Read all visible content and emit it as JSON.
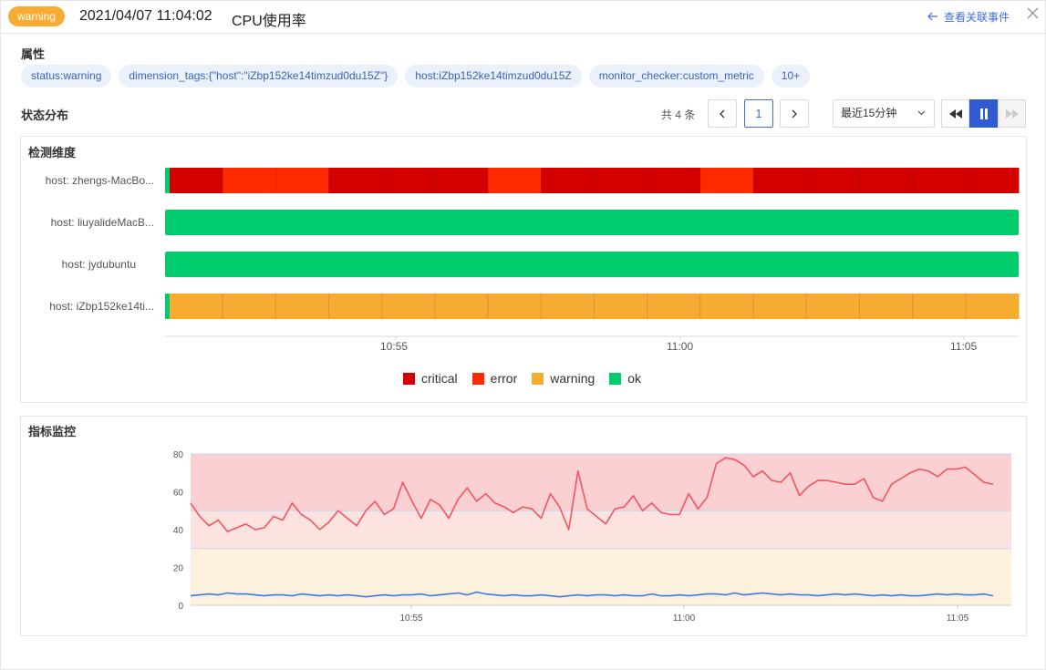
{
  "header": {
    "status_badge": "warning",
    "time": "2021/04/07 11:04:02",
    "title": "CPU使用率",
    "related_link": "查看关联事件"
  },
  "attributes": {
    "title": "属性",
    "tags": [
      "status:warning",
      "dimension_tags:{\"host\":\"iZbp152ke14timzud0du15Z\"}",
      "host:iZbp152ke14timzud0du15Z",
      "monitor_checker:custom_metric",
      "10+"
    ]
  },
  "status_dist": {
    "title": "状态分布",
    "total": "共 4 条",
    "page": "1",
    "time_range": "最近15分钟"
  },
  "detection": {
    "title": "检测维度",
    "rows": [
      {
        "label": "host: zhengs-MacBo...",
        "segments": [
          "ok",
          "critical",
          "error",
          "error",
          "critical",
          "critical",
          "critical",
          "error",
          "critical",
          "critical",
          "critical",
          "error",
          "critical",
          "critical",
          "critical",
          "critical",
          "critical"
        ]
      },
      {
        "label": "host: liuyalideMacB...",
        "segments": [
          "ok"
        ]
      },
      {
        "label": "host: jydubuntu",
        "segments": [
          "ok"
        ]
      },
      {
        "label": "host: iZbp152ke14ti...",
        "segments": [
          "ok",
          "warning",
          "warning",
          "warning",
          "warning",
          "warning",
          "warning",
          "warning",
          "warning",
          "warning",
          "warning",
          "warning",
          "warning",
          "warning",
          "warning",
          "warning",
          "warning"
        ]
      }
    ],
    "x_ticks": [
      "10:55",
      "11:00",
      "11:05"
    ],
    "colors": {
      "critical": "#d40000",
      "error": "#ff2a00",
      "warning": "#f7ab31",
      "ok": "#00cc6e"
    },
    "legend": [
      "critical",
      "error",
      "warning",
      "ok"
    ]
  },
  "metrics": {
    "title": "指标监控"
  },
  "chart_data": {
    "type": "line",
    "x_ticks": [
      "10:55",
      "11:00",
      "11:05"
    ],
    "y_ticks": [
      0,
      20,
      40,
      60,
      80
    ],
    "ylim": [
      0,
      80
    ],
    "thresholds": [
      {
        "from": 50,
        "to": 80,
        "color": "#fbd0d2"
      },
      {
        "from": 30,
        "to": 50,
        "color": "#fde3df"
      },
      {
        "from": 0,
        "to": 30,
        "color": "#fdf0dc"
      }
    ],
    "series": [
      {
        "color": "#f25562",
        "values": [
          54,
          47,
          42,
          45,
          39,
          41,
          43,
          40,
          41,
          47,
          45,
          54,
          48,
          45,
          40,
          44,
          50,
          46,
          42,
          50,
          55,
          48,
          51,
          65,
          55,
          46,
          56,
          53,
          46,
          56,
          62,
          55,
          59,
          54,
          52,
          49,
          52,
          51,
          46,
          59,
          52,
          40,
          71,
          51,
          47,
          43,
          51,
          52,
          58,
          50,
          54,
          49,
          48,
          48,
          59,
          51,
          57,
          75,
          78,
          77,
          74,
          68,
          71,
          66,
          65,
          70,
          58,
          63,
          66,
          66,
          65,
          64,
          64,
          67,
          57,
          55,
          64,
          67,
          70,
          72,
          71,
          68,
          72,
          72,
          73,
          69,
          65,
          64
        ]
      },
      {
        "color": "#3f78e8",
        "values": [
          5,
          5.5,
          6,
          5.5,
          6.5,
          6,
          6,
          5.5,
          5,
          5.5,
          5.5,
          5,
          6,
          5.5,
          5,
          5.5,
          5,
          5.5,
          5,
          4.5,
          5,
          5.5,
          5,
          5.5,
          5.5,
          6,
          5,
          5.5,
          6,
          6.5,
          5.5,
          7,
          6,
          5.5,
          5,
          5.5,
          5,
          5,
          5.5,
          5,
          4.5,
          5,
          5.5,
          5,
          5.5,
          5.5,
          5,
          5.5,
          5,
          5,
          6,
          5,
          5,
          5.5,
          5,
          5.5,
          6,
          6,
          5.5,
          6.5,
          5.5,
          6,
          6.5,
          6,
          5.5,
          6,
          5.5,
          5.5,
          5,
          5.5,
          6,
          5.5,
          6,
          5.5,
          5,
          5.5,
          5,
          5.5,
          5,
          5,
          5.5,
          6,
          5.5,
          6,
          5.5,
          5.5,
          6,
          5
        ]
      }
    ]
  }
}
